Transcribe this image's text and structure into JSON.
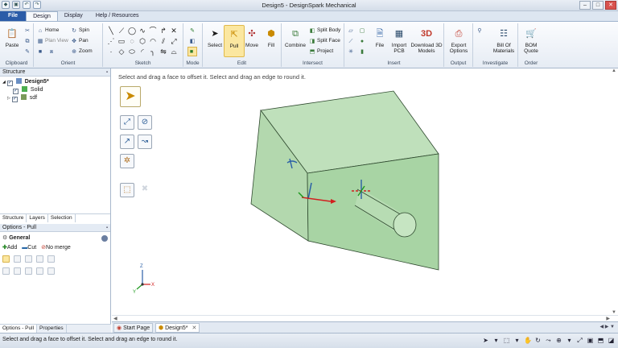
{
  "app": {
    "title": "Design5 - DesignSpark Mechanical"
  },
  "window": {
    "minimize": "–",
    "maximize": "□",
    "close": "✕"
  },
  "quick_access": [
    "save-icon",
    "undo-icon",
    "redo-icon"
  ],
  "ribbon_tabs": [
    "File",
    "Design",
    "Display",
    "Help / Resources"
  ],
  "ribbon": {
    "clipboard": {
      "paste": "Paste",
      "label": "Clipboard"
    },
    "orient": {
      "home": "Home",
      "spin": "Spin",
      "plan_view": "Plan View",
      "pan": "Pan",
      "zoom": "Zoom",
      "label": "Orient"
    },
    "sketch": {
      "label": "Sketch"
    },
    "mode": {
      "label": "Mode"
    },
    "edit": {
      "select": "Select",
      "pull": "Pull",
      "move": "Move",
      "fill": "Fill",
      "label": "Edit"
    },
    "intersect": {
      "combine": "Combine",
      "split_body": "Split Body",
      "split_face": "Split Face",
      "project": "Project",
      "label": "Intersect"
    },
    "insert": {
      "file": "File",
      "import_pcb": "Import PCB",
      "download_3d": "Download 3D Models",
      "logo_3d": "3D",
      "label": "Insert"
    },
    "output": {
      "export": "Export Options",
      "label": "Output"
    },
    "investigate": {
      "bom": "Bill Of Materials",
      "label": "Investigate"
    },
    "order": {
      "bom_quote": "BOM Quote",
      "label": "Order"
    }
  },
  "structure": {
    "header": "Structure",
    "pin": "▪",
    "items": [
      {
        "label": "Design5*",
        "expander": "◢"
      },
      {
        "label": "Solid"
      },
      {
        "label": "sdf",
        "expander": "▷"
      }
    ],
    "check": "✓",
    "tabs": [
      "Structure",
      "Layers",
      "Selection"
    ]
  },
  "options": {
    "header": "Options - Pull",
    "section": "General",
    "add": "Add",
    "cut": "Cut",
    "no_merge": "No merge"
  },
  "left_bottom_tabs": [
    "Options - Pull",
    "Properties"
  ],
  "viewport": {
    "hint": "Select and drag a face to offset it. Select and drag an edge to round it.",
    "axis_x": "X",
    "axis_y": "Y",
    "axis_z": "Z",
    "model_color": "#a8d4a4",
    "scroll_up": "▲",
    "scroll_down": "▼",
    "scroll_left": "◀",
    "scroll_right": "▶"
  },
  "doc_tabs": [
    {
      "label": "Start Page"
    },
    {
      "label": "Design5*",
      "close": "✕"
    }
  ],
  "doc_tab_nav": "◀ ▶ ▼",
  "status": {
    "text": "Select and drag a face to offset it. Select and drag an edge to round it."
  }
}
